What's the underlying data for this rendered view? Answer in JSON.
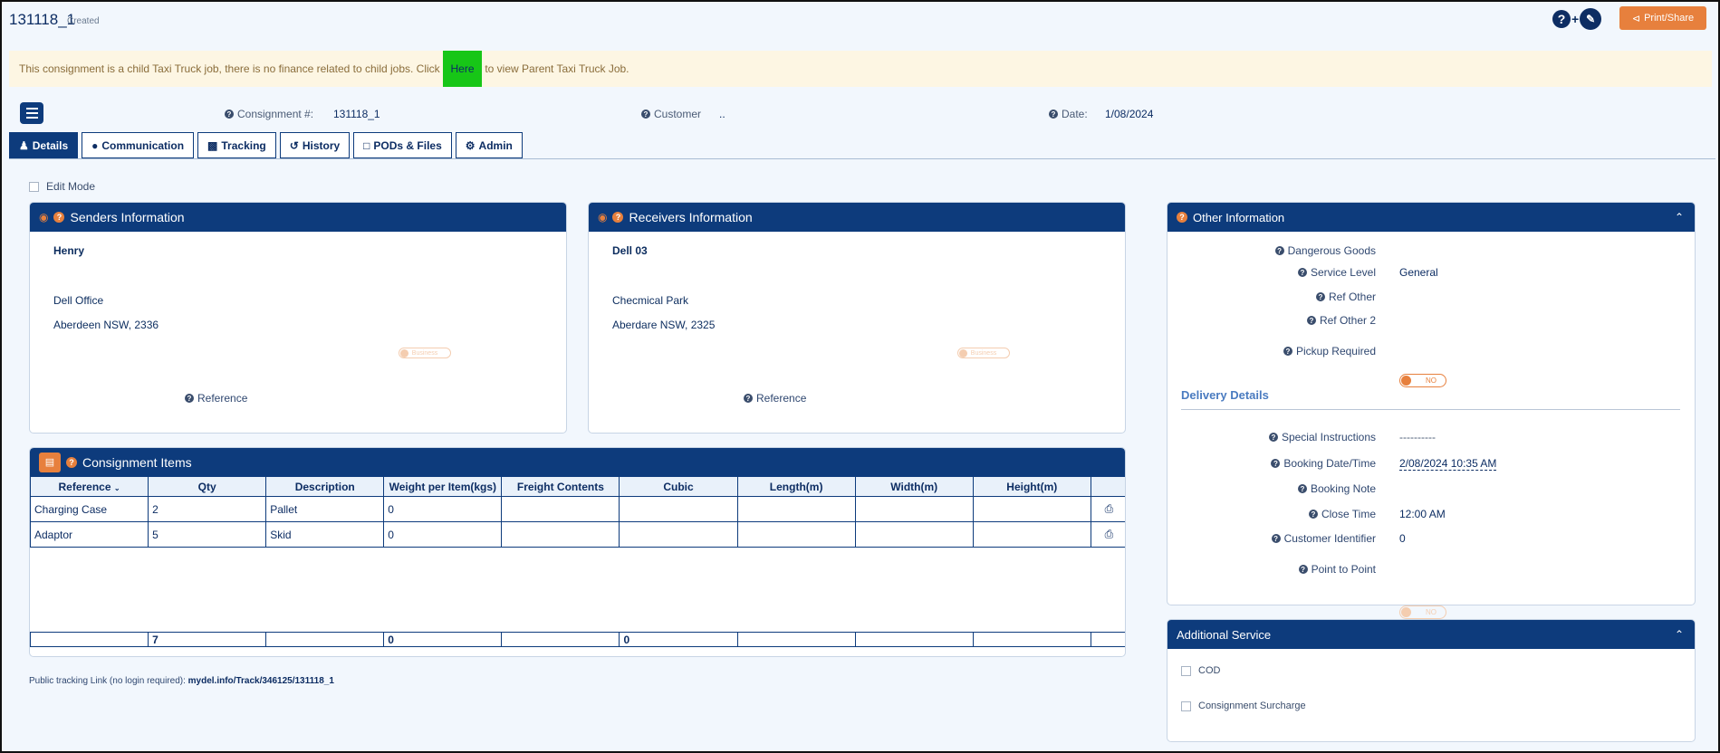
{
  "header": {
    "title": "131118_1",
    "status": "Created",
    "print_label": "Print/Share"
  },
  "banner": {
    "text_before": "This consignment is a child Taxi Truck job, there is no finance related to child jobs. Click ",
    "link": "Here",
    "text_after": " to view Parent Taxi Truck Job."
  },
  "summary": {
    "consignment_label": "Consignment #:",
    "consignment_value": "131118_1",
    "customer_label": "Customer",
    "customer_value": "..",
    "date_label": "Date:",
    "date_value": "1/08/2024"
  },
  "tabs": [
    {
      "label": "Details",
      "icon": "user-icon"
    },
    {
      "label": "Communication",
      "icon": "comment-icon"
    },
    {
      "label": "Tracking",
      "icon": "truck-icon"
    },
    {
      "label": "History",
      "icon": "history-icon"
    },
    {
      "label": "PODs & Files",
      "icon": "file-icon"
    },
    {
      "label": "Admin",
      "icon": "gear-icon"
    }
  ],
  "edit_mode_label": "Edit Mode",
  "senders": {
    "title": "Senders Information",
    "name": "Henry",
    "line1": "Dell Office",
    "line2": "Aberdeen NSW, 2336",
    "toggle": "Business",
    "reference_label": "Reference"
  },
  "receivers": {
    "title": "Receivers Information",
    "name": "Dell 03",
    "line1": "Checmical Park",
    "line2": "Aberdare NSW, 2325",
    "toggle": "Business",
    "reference_label": "Reference"
  },
  "items": {
    "title": "Consignment Items",
    "columns": [
      "Reference",
      "Qty",
      "Description",
      "Weight per Item(kgs)",
      "Freight Contents",
      "Cubic",
      "Length(m)",
      "Width(m)",
      "Height(m)"
    ],
    "rows": [
      {
        "reference": "Charging Case",
        "qty": "2",
        "description": "Pallet",
        "weight": "0"
      },
      {
        "reference": "Adaptor",
        "qty": "5",
        "description": "Skid",
        "weight": "0"
      }
    ],
    "totals": {
      "qty": "7",
      "weight": "0",
      "cubic": "0"
    }
  },
  "tracking": {
    "label": "Public tracking Link (no login required):",
    "link": "mydel.info/Track/346125/131118_1"
  },
  "other": {
    "title": "Other Information",
    "fields": [
      {
        "label": "Dangerous Goods",
        "value": ""
      },
      {
        "label": "Service Level",
        "value": "General"
      },
      {
        "label": "Ref Other",
        "value": ""
      },
      {
        "label": "Ref Other 2",
        "value": ""
      }
    ],
    "pickup_label": "Pickup Required",
    "pickup_toggle": "NO",
    "delivery_title": "Delivery Details",
    "special_label": "Special Instructions",
    "special_value": "----------",
    "booking_label": "Booking Date/Time",
    "booking_value": "2/08/2024 10:35 AM",
    "note_label": "Booking Note",
    "close_label": "Close Time",
    "close_value": "12:00 AM",
    "cust_id_label": "Customer Identifier",
    "cust_id_value": "0",
    "p2p_label": "Point to Point",
    "p2p_toggle": "NO"
  },
  "additional": {
    "title": "Additional Service",
    "options": [
      "COD",
      "Consignment Surcharge"
    ]
  }
}
